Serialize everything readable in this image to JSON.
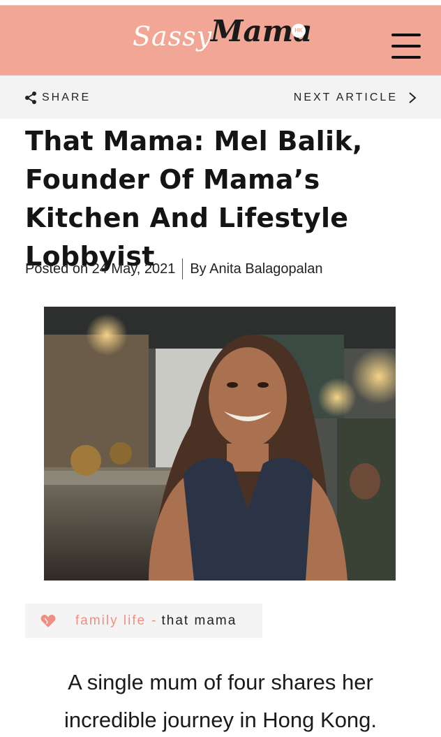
{
  "brand": {
    "logo_word1": "Sassy",
    "logo_word2": "Mama",
    "logo_badge": "HK",
    "header_color": "#f2a695"
  },
  "toolbar": {
    "share_label": "SHARE",
    "next_label": "NEXT ARTICLE"
  },
  "article": {
    "title": "That Mama: Mel Balik, Founder Of Mama’s Kitchen And Lifestyle Lobbyist",
    "posted_label": "Posted on 24 May, 2021",
    "author_label": "By Anita Balagopalan",
    "hero_image_alt": "portrait-photo",
    "dek": "A single mum of four shares her incredible journey in Hong Kong."
  },
  "tags": {
    "primary": "family life",
    "separator": "-",
    "secondary": "that mama",
    "accent_color": "#ef8f82"
  },
  "icons": {
    "share": "share-icon",
    "next": "chevron-right-icon",
    "menu": "hamburger-menu-icon",
    "tag": "heart-icon"
  }
}
